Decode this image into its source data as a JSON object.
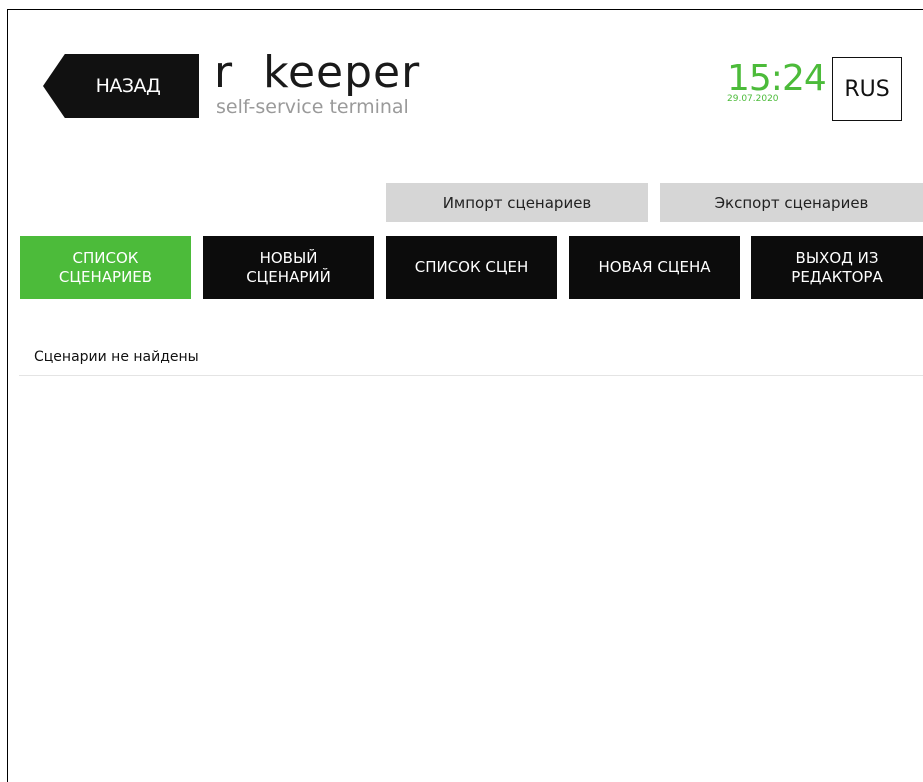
{
  "header": {
    "back_label": "НАЗАД",
    "logo": {
      "main": "r  keeper",
      "sub": "self-service terminal"
    },
    "clock": {
      "time": "15:24",
      "date": "29.07.2020"
    },
    "language": "RUS"
  },
  "actions": {
    "import_label": "Импорт сценариев",
    "export_label": "Экспорт сценариев"
  },
  "nav": {
    "items": [
      {
        "label": "СПИСОК\nСЦЕНАРИЕВ",
        "active": true
      },
      {
        "label": "НОВЫЙ\nСЦЕНАРИЙ",
        "active": false
      },
      {
        "label": "СПИСОК СЦЕН",
        "active": false
      },
      {
        "label": "НОВАЯ СЦЕНА",
        "active": false
      },
      {
        "label": "ВЫХОД ИЗ\nРЕДАКТОРА",
        "active": false
      }
    ]
  },
  "main": {
    "empty_message": "Сценарии не найдены"
  },
  "colors": {
    "accent": "#4cbb3a",
    "button_dark": "#0c0c0c",
    "button_grey": "#d6d6d6"
  }
}
